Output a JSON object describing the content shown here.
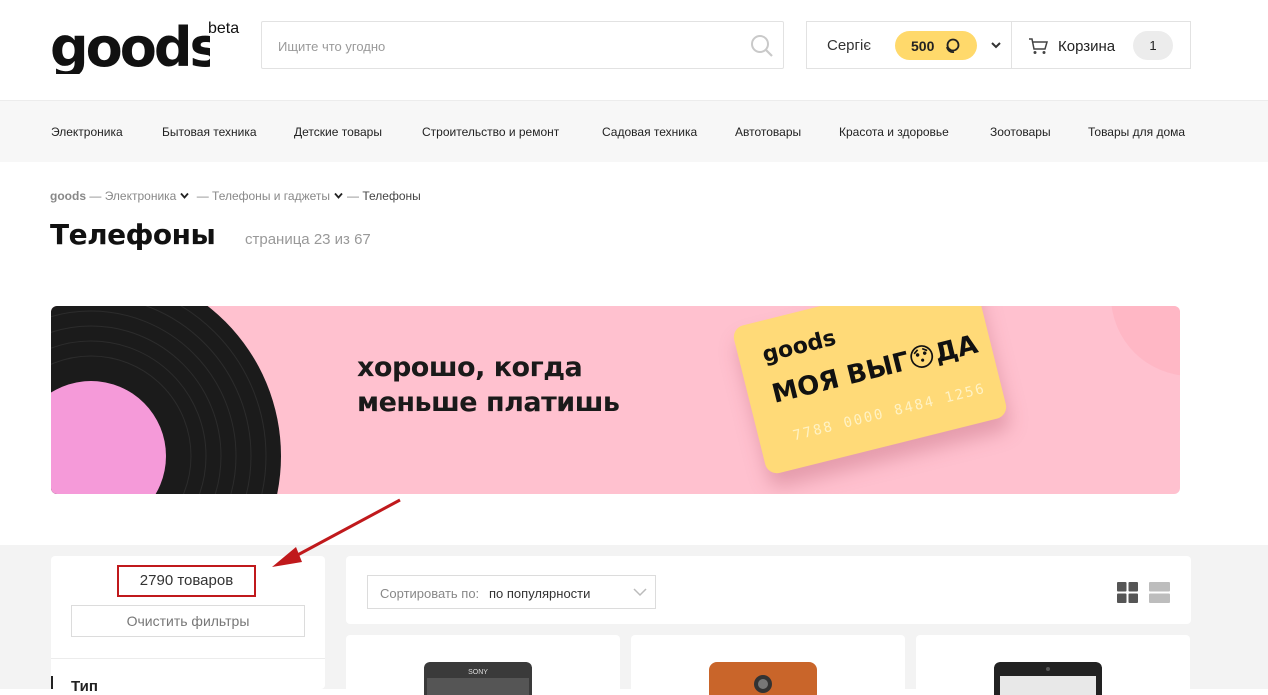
{
  "header": {
    "logo_text": "goods",
    "logo_badge": "beta",
    "search_placeholder": "Ищите что угодно",
    "user_name": "Сергіє",
    "bonus_points": "500",
    "cart_label": "Корзина",
    "cart_count": "1"
  },
  "categories": [
    "Электроника",
    "Бытовая техника",
    "Детские товары",
    "Строительство и ремонт",
    "Садовая техника",
    "Автотовары",
    "Красота и здоровье",
    "Зоотовары",
    "Товары для дома"
  ],
  "breadcrumbs": {
    "home": "goods",
    "sep": "—",
    "level1": "Электроника",
    "level2": "Телефоны и гаджеты",
    "current": "Телефоны"
  },
  "page": {
    "title": "Телефоны",
    "page_info": "страница 23 из 67"
  },
  "banner": {
    "line1": "хорошо, когда",
    "line2": "меньше платишь",
    "card_logo": "goods",
    "card_title": "МОЯ ВЫГ😯ДА",
    "card_number": "7788 0000 8484 1256"
  },
  "sidebar": {
    "product_count": "2790 товаров",
    "clear_filters": "Очистить фильтры",
    "filter_type": "Тип"
  },
  "sort": {
    "label": "Сортировать по:",
    "value": "по популярности"
  },
  "products": [
    {
      "brand": "SONY"
    },
    {
      "brand": ""
    },
    {
      "brand": ""
    }
  ],
  "colors": {
    "accent_yellow": "#ffd96b",
    "banner_pink": "#ffc1cf",
    "annotation_red": "#c0191c"
  }
}
